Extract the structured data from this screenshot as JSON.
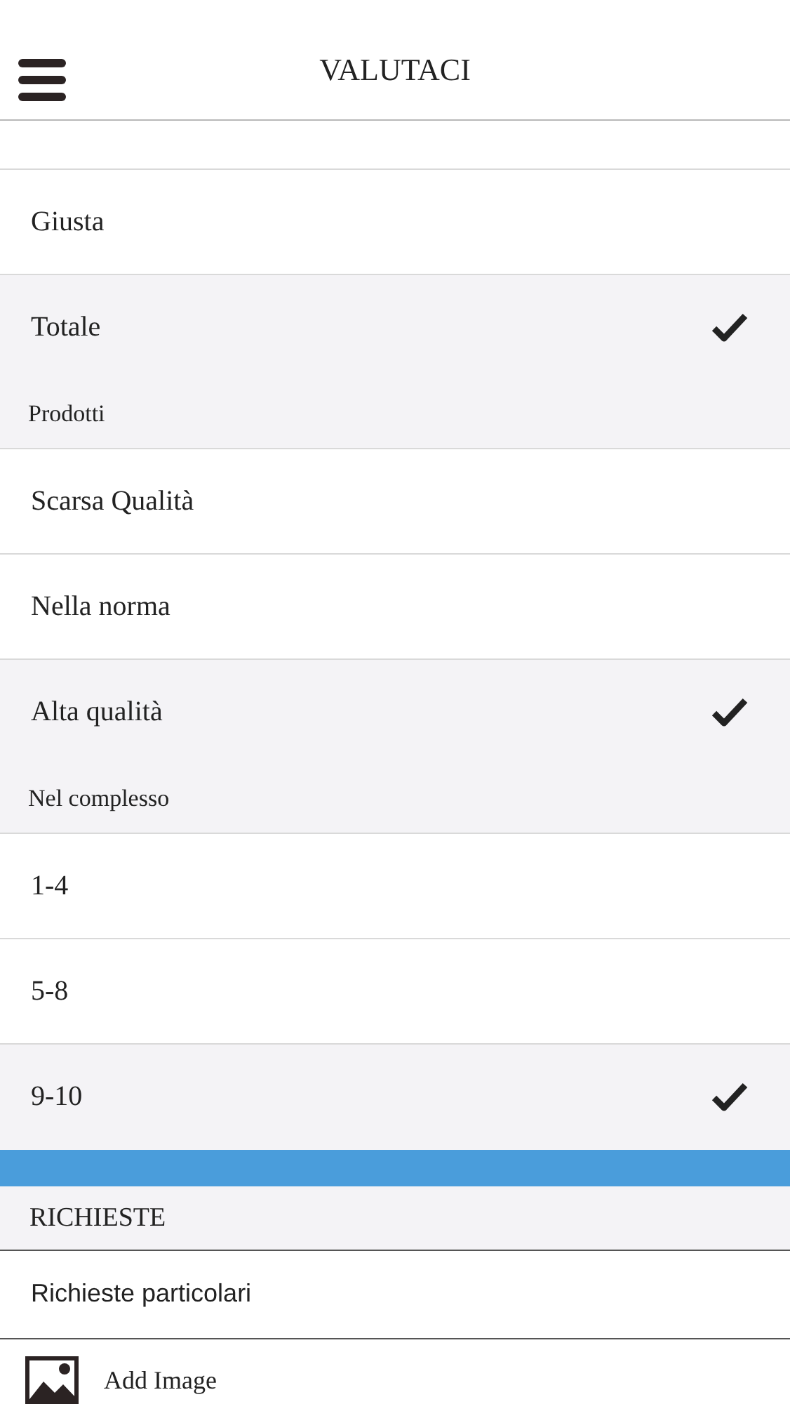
{
  "header": {
    "title": "VALUTACI"
  },
  "groups": [
    {
      "options": [
        {
          "label": "Giusta",
          "selected": false
        },
        {
          "label": "Totale",
          "selected": true
        }
      ]
    },
    {
      "label": "Prodotti",
      "options": [
        {
          "label": "Scarsa Qualità",
          "selected": false
        },
        {
          "label": "Nella norma",
          "selected": false
        },
        {
          "label": "Alta qualità",
          "selected": true
        }
      ]
    },
    {
      "label": "Nel complesso",
      "options": [
        {
          "label": "1-4",
          "selected": false
        },
        {
          "label": "5-8",
          "selected": false
        },
        {
          "label": "9-10",
          "selected": true
        }
      ]
    }
  ],
  "requests": {
    "title": "RICHIESTE",
    "placeholder": "Richieste particolari",
    "add_image": "Add Image"
  }
}
